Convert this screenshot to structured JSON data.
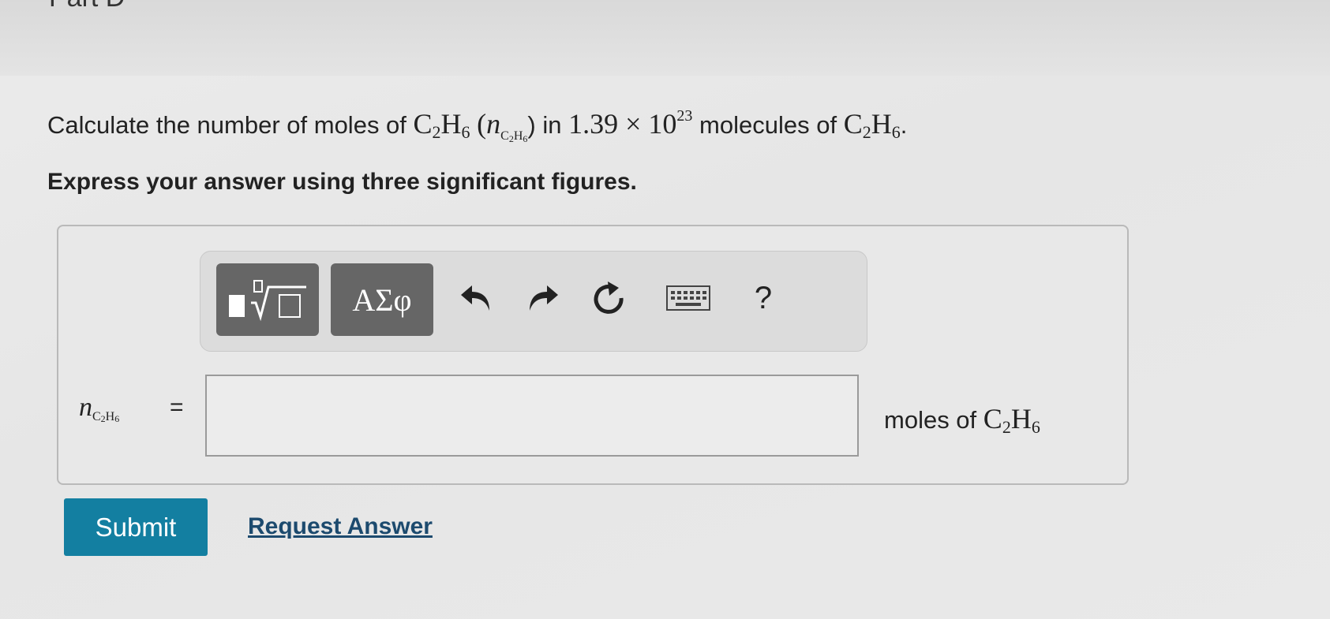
{
  "part_title": "Part D",
  "question": {
    "prefix": "Calculate the number of moles of",
    "formula": "C2H6",
    "symbol": "n",
    "in": "in",
    "mantissa": "1.39",
    "times": "×",
    "base": "10",
    "exponent": "23",
    "molecules_of": "molecules of",
    "period": "."
  },
  "instruction": "Express your answer using three significant figures.",
  "toolbar": {
    "greek_label": "ΑΣφ",
    "help_label": "?"
  },
  "answer": {
    "lhs_symbol": "n",
    "lhs_sub": "C2H6",
    "equals": "=",
    "value": "",
    "unit_prefix": "moles of",
    "unit_formula": "C2H6"
  },
  "actions": {
    "submit_label": "Submit",
    "request_label": "Request Answer"
  },
  "colors": {
    "submit_bg": "#137fa1",
    "link": "#1c4a6e",
    "toolbar_btn": "#666666"
  }
}
